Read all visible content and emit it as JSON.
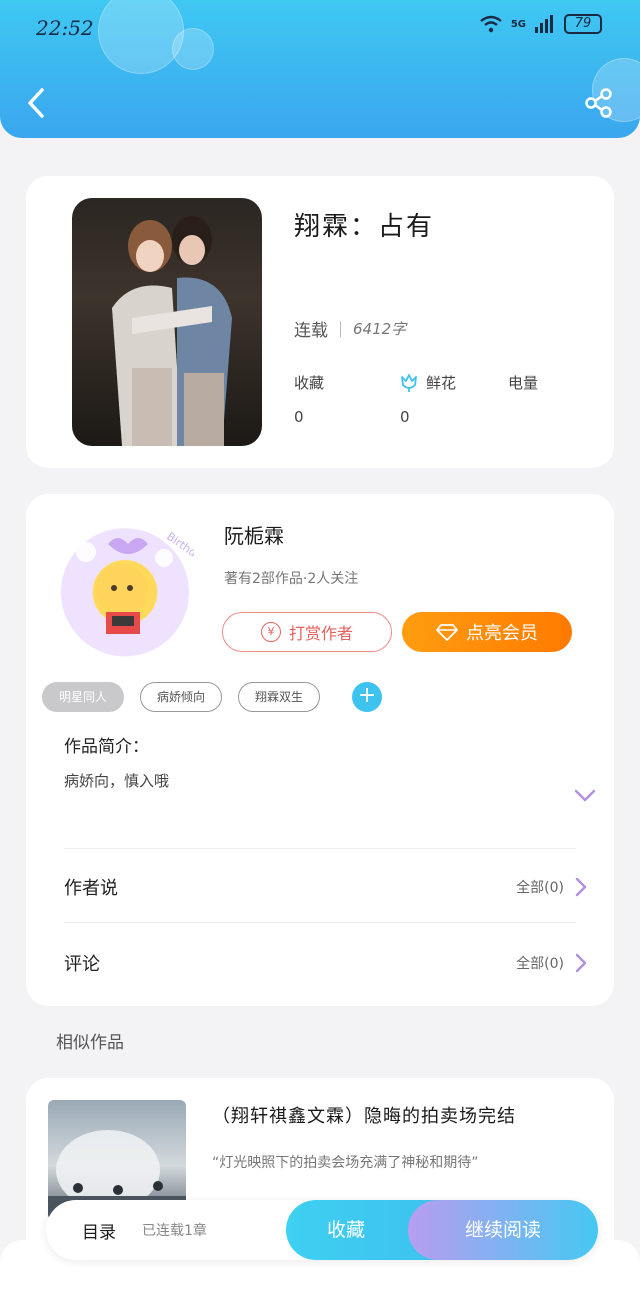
{
  "status_bar": {
    "time": "22:52",
    "network": "5G",
    "battery": "79"
  },
  "book": {
    "title": "翔霖：占有",
    "status": "连载",
    "word_count": "6412字",
    "stats": [
      {
        "label": "收藏",
        "value": "0"
      },
      {
        "label": "鲜花",
        "value": "0"
      },
      {
        "label": "电量",
        "value": ""
      }
    ]
  },
  "author": {
    "name": "阮栀霖",
    "subtitle": "著有2部作品·2人关注",
    "tip_label": "打赏作者",
    "tip_icon_text": "¥",
    "vip_label": "点亮会员",
    "avatar_caption": "Birthday"
  },
  "tags": [
    "明星同人",
    "病娇倾向",
    "翔霖双生"
  ],
  "intro": {
    "label": "作品简介：",
    "text": "病娇向，慎入哦"
  },
  "author_says": {
    "label": "作者说",
    "right": "全部(0)"
  },
  "comments": {
    "label": "评论",
    "right": "全部(0)"
  },
  "similar": {
    "section_label": "相似作品",
    "items": [
      {
        "title": "（翔轩祺鑫文霖）隐晦的拍卖场完结",
        "desc": "“灯光映照下的拍卖会场充满了神秘和期待”"
      }
    ]
  },
  "bottom_bar": {
    "toc_label": "目录",
    "toc_status": "已连载1章",
    "favorite_label": "收藏",
    "continue_label": "继续阅读"
  }
}
